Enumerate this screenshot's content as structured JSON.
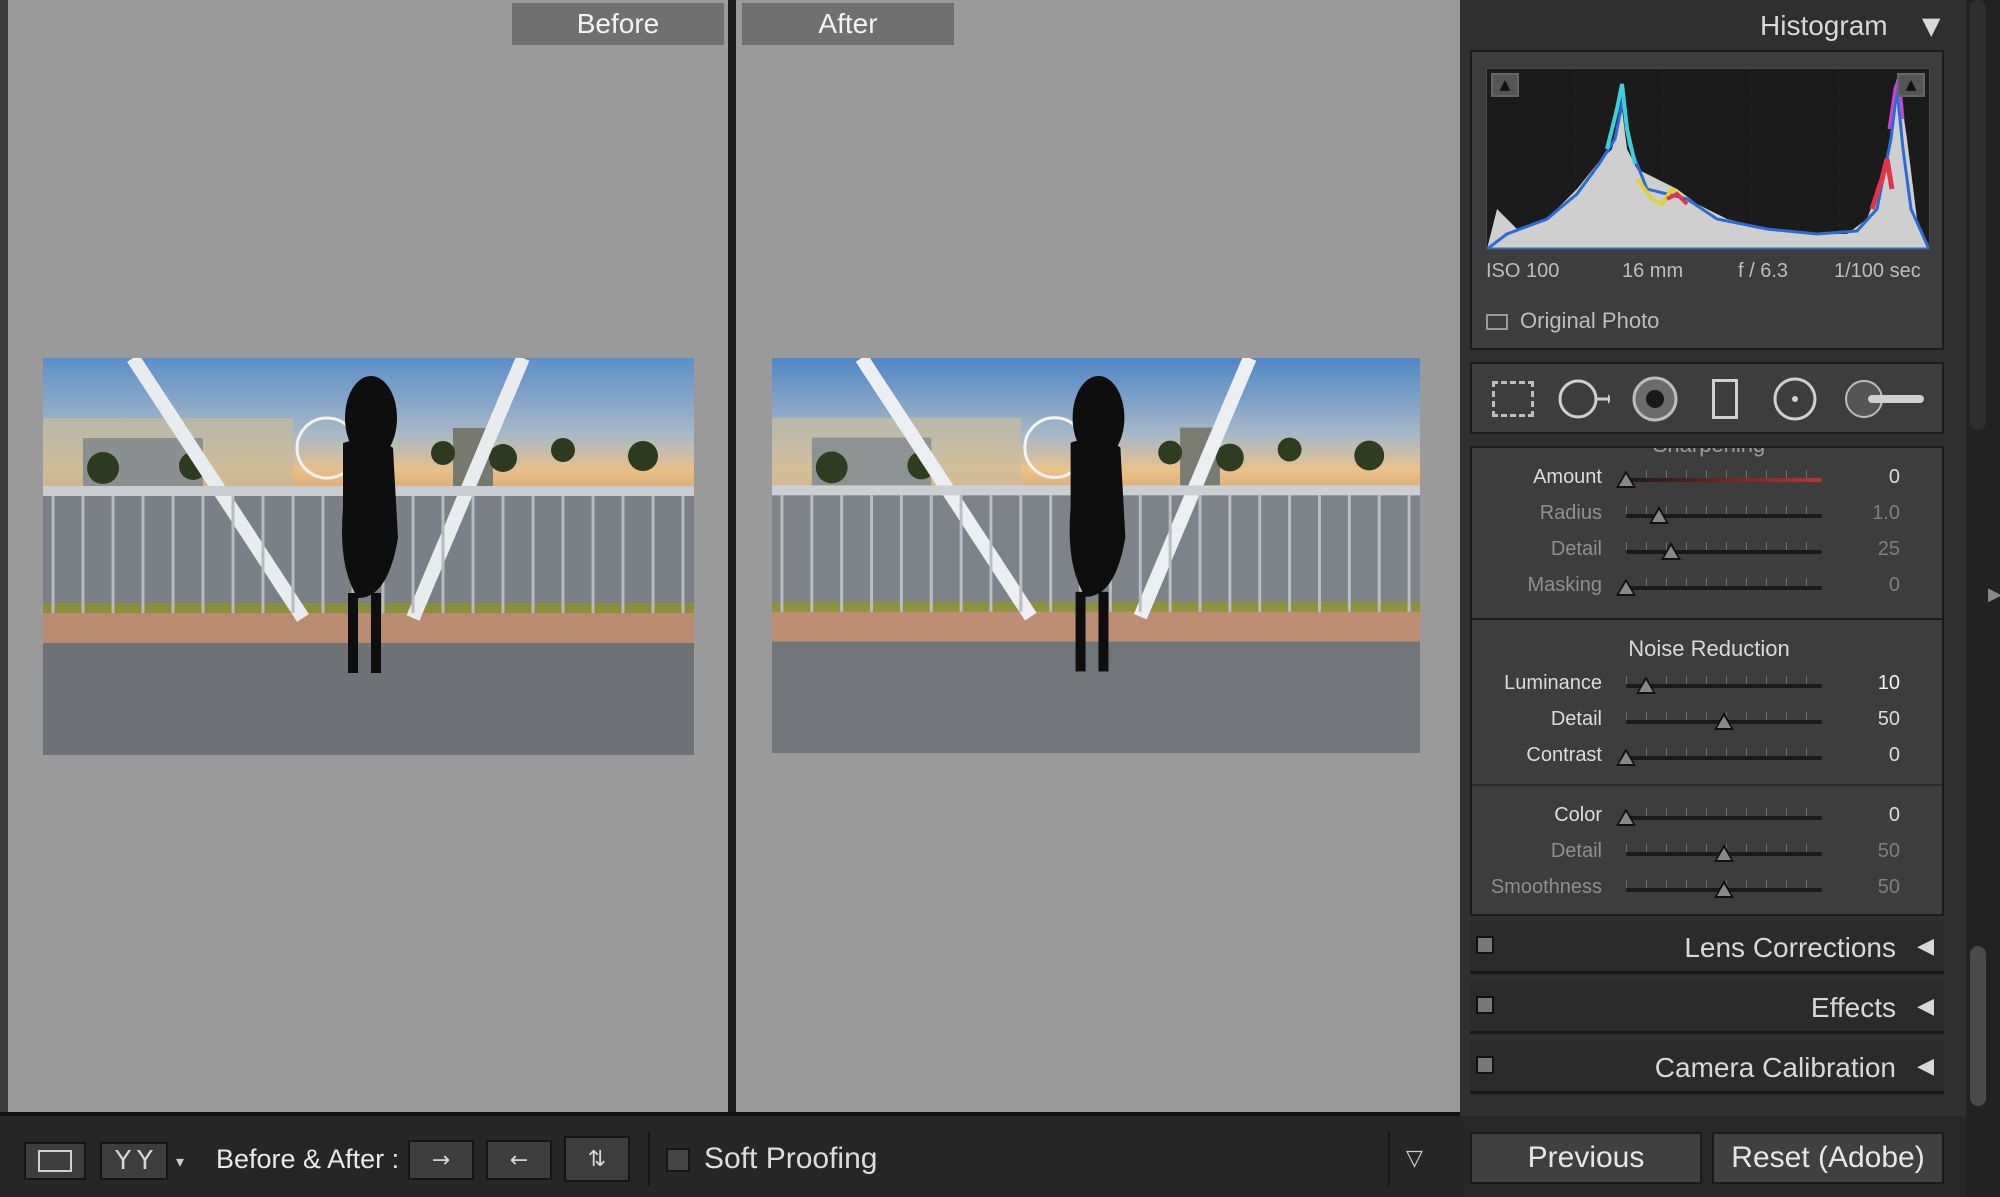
{
  "compare": {
    "before_label": "Before",
    "after_label": "After"
  },
  "toolbar": {
    "view_mode_icon": "loupe-icon",
    "yy_label_1": "Y",
    "yy_label_2": "Y",
    "before_after_label": "Before & After :",
    "soft_proofing_label": "Soft Proofing"
  },
  "histogram": {
    "title": "Histogram",
    "iso": "ISO 100",
    "focal": "16 mm",
    "aperture": "f / 6.3",
    "shutter": "1/100 sec",
    "original_photo": "Original Photo"
  },
  "sharpening": {
    "title": "Sharpening",
    "sliders": [
      {
        "label": "Amount",
        "value": "0",
        "pos": 0.0,
        "dim": false
      },
      {
        "label": "Radius",
        "value": "1.0",
        "pos": 0.17,
        "dim": true
      },
      {
        "label": "Detail",
        "value": "25",
        "pos": 0.23,
        "dim": true
      },
      {
        "label": "Masking",
        "value": "0",
        "pos": 0.0,
        "dim": true
      }
    ]
  },
  "noise_reduction": {
    "title": "Noise Reduction",
    "sliders": [
      {
        "label": "Luminance",
        "value": "10",
        "pos": 0.1,
        "dim": false
      },
      {
        "label": "Detail",
        "value": "50",
        "pos": 0.5,
        "dim": false
      },
      {
        "label": "Contrast",
        "value": "0",
        "pos": 0.0,
        "dim": false
      },
      {
        "label": "Color",
        "value": "0",
        "pos": 0.0,
        "dim": false
      },
      {
        "label": "Detail",
        "value": "50",
        "pos": 0.5,
        "dim": true
      },
      {
        "label": "Smoothness",
        "value": "50",
        "pos": 0.5,
        "dim": true
      }
    ]
  },
  "panels": {
    "lens_corrections": "Lens Corrections",
    "effects": "Effects",
    "camera_calibration": "Camera Calibration"
  },
  "buttons": {
    "previous": "Previous",
    "reset": "Reset (Adobe)"
  },
  "colors": {
    "accent_red": "#c0392b",
    "panel_bg": "#3d3d3d",
    "canvas_bg": "#9a9a9a"
  }
}
